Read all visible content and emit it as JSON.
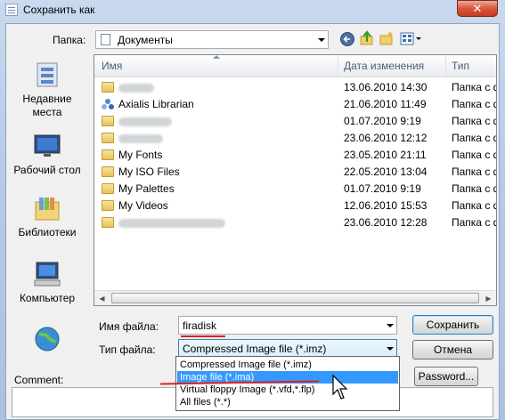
{
  "window": {
    "title": "Сохранить как",
    "close_glyph": "✕"
  },
  "toolbar": {
    "location_label": "Папка:",
    "location_value": "Документы",
    "icons": [
      "back-icon",
      "up-folder-icon",
      "new-folder-icon",
      "views-menu-icon"
    ]
  },
  "places": [
    {
      "label": "Недавние места",
      "icon": "recent-places-icon"
    },
    {
      "label": "Рабочий стол",
      "icon": "desktop-icon"
    },
    {
      "label": "Библиотеки",
      "icon": "libraries-icon"
    },
    {
      "label": "Компьютер",
      "icon": "computer-icon"
    },
    {
      "label": "",
      "icon": "network-icon"
    }
  ],
  "columns": {
    "name": "Имя",
    "date": "Дата изменения",
    "type": "Тип"
  },
  "files": [
    {
      "name": "",
      "date": "13.06.2010 14:30",
      "type": "Папка с ф",
      "blurred": true,
      "blur_w": 40,
      "icon": "folder-icon"
    },
    {
      "name": "Axialis Librarian",
      "date": "21.06.2010 11:49",
      "type": "Папка с ф",
      "blurred": false,
      "icon": "axialis-icon"
    },
    {
      "name": "",
      "date": "01.07.2010 9:19",
      "type": "Папка с ф",
      "blurred": true,
      "blur_w": 60,
      "icon": "folder-icon"
    },
    {
      "name": "",
      "date": "23.06.2010 12:12",
      "type": "Папка с ф",
      "blurred": true,
      "blur_w": 50,
      "icon": "folder-icon"
    },
    {
      "name": "My Fonts",
      "date": "23.05.2010 21:11",
      "type": "Папка с ф",
      "blurred": false,
      "icon": "folder-icon"
    },
    {
      "name": "My ISO Files",
      "date": "22.05.2010 13:04",
      "type": "Папка с ф",
      "blurred": false,
      "icon": "folder-icon"
    },
    {
      "name": "My Palettes",
      "date": "01.07.2010 9:19",
      "type": "Папка с ф",
      "blurred": false,
      "icon": "folder-icon"
    },
    {
      "name": "My Videos",
      "date": "12.06.2010 15:53",
      "type": "Папка с ф",
      "blurred": false,
      "icon": "folder-icon"
    },
    {
      "name": "",
      "date": "23.06.2010 12:28",
      "type": "Папка с ф",
      "blurred": true,
      "blur_w": 120,
      "icon": "folder-icon"
    }
  ],
  "form": {
    "filename_label": "Имя файла:",
    "filename_value": "firadisk",
    "filetype_label": "Тип файла:",
    "filetype_value": "Compressed Image file (*.imz)",
    "comment_label": "Comment:"
  },
  "buttons": {
    "save": "Сохранить",
    "cancel": "Отмена",
    "password": "Password..."
  },
  "filetype_options": [
    {
      "label": "Compressed Image file (*.imz)",
      "selected": false
    },
    {
      "label": "Image file (*.ima)",
      "selected": true
    },
    {
      "label": "Virtual floppy Image (*.vfd,*.flp)",
      "selected": false
    },
    {
      "label": "All files (*.*)",
      "selected": false
    }
  ],
  "colors": {
    "selection": "#3399ff",
    "annotation": "#e0201a"
  }
}
